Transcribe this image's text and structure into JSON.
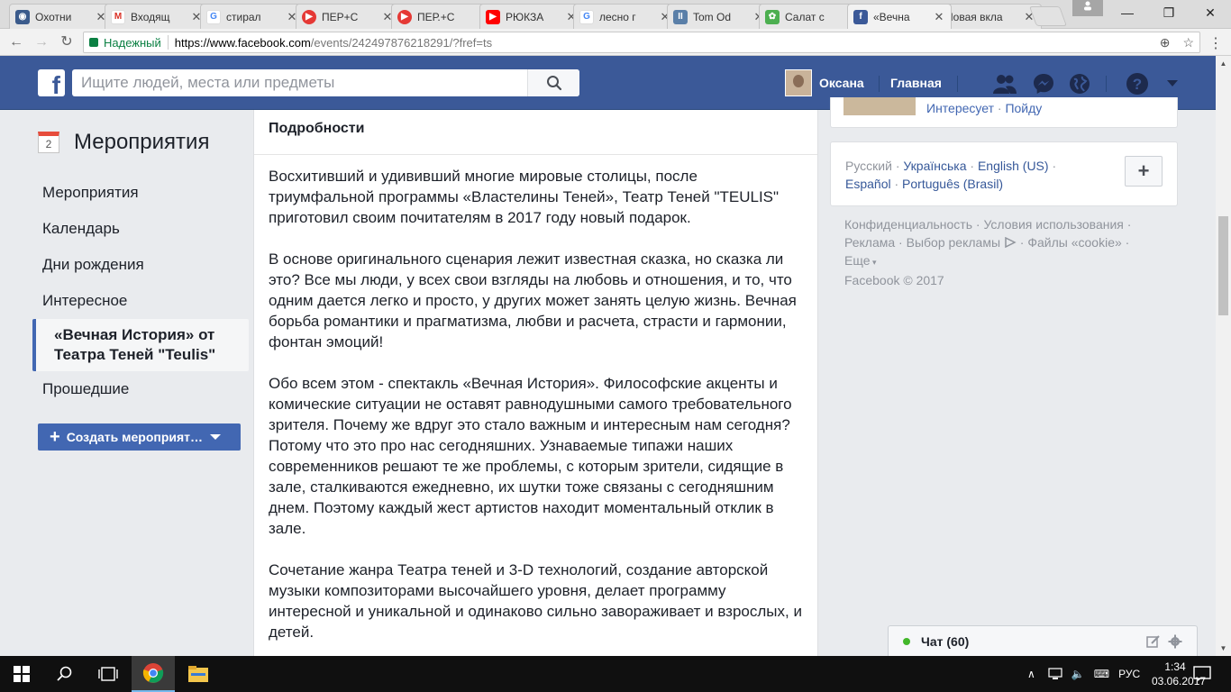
{
  "browser": {
    "tabs": [
      {
        "label": "Охотни",
        "icon": "globe-icon",
        "color": "#3b5b8c",
        "glyph": "◉",
        "active": false
      },
      {
        "label": "Входящ",
        "icon": "gmail-icon",
        "color": "#d93025",
        "glyph": "M",
        "active": false
      },
      {
        "label": "стирал",
        "icon": "google-icon",
        "color": "#4285f4",
        "glyph": "G",
        "active": false
      },
      {
        "label": "ПЕР+С",
        "icon": "media-play-icon",
        "color": "#e53935",
        "glyph": "▶",
        "active": false
      },
      {
        "label": "ПЕР.+С",
        "icon": "media-play-icon",
        "color": "#e53935",
        "glyph": "▶",
        "active": false
      },
      {
        "label": "РЮКЗА",
        "icon": "youtube-icon",
        "color": "#ff0000",
        "glyph": "▶",
        "active": false
      },
      {
        "label": "лесно г",
        "icon": "google-icon",
        "color": "#4285f4",
        "glyph": "G",
        "active": false
      },
      {
        "label": "Tom Od",
        "icon": "pause-icon",
        "color": "#5a7fa8",
        "glyph": "II",
        "active": false
      },
      {
        "label": "Салат с",
        "icon": "leaf-icon",
        "color": "#4caf50",
        "glyph": "✿",
        "active": false
      },
      {
        "label": "«Вечна",
        "icon": "facebook-icon",
        "color": "#3b5998",
        "glyph": "f",
        "active": true
      },
      {
        "label": "Новая вкла",
        "icon": "",
        "color": "",
        "glyph": "",
        "active": false
      }
    ],
    "security_label": "Надежный",
    "url_host": "https://www.facebook.com",
    "url_path": "/events/242497876218291/?fref=ts"
  },
  "fb": {
    "search_placeholder": "Ищите людей, места или предметы",
    "user_name": "Оксана",
    "home_label": "Главная"
  },
  "leftnav": {
    "title": "Мероприятия",
    "calendar_day": "2",
    "items": [
      {
        "label": "Мероприятия"
      },
      {
        "label": "Календарь"
      },
      {
        "label": "Дни рождения"
      },
      {
        "label": "Интересное"
      },
      {
        "label": "«Вечная История» от Театра Теней \"Teulis\"",
        "active": true
      },
      {
        "label": "Прошедшие"
      }
    ],
    "create_button": "Создать мероприят…"
  },
  "details": {
    "heading": "Подробности",
    "paragraphs": [
      "Восхитивший и удививший многие мировые столицы, после триумфальной программы «Властелины Теней», Театр Теней \"TEULIS\" приготовил своим почитателям в 2017 году новый подарок.",
      "В основе оригинального сценария лежит известная сказка, но сказка ли это? Все мы люди, у всех свои взгляды на любовь и отношения, и то, что одним дается легко и просто, у других может занять целую жизнь. Вечная борьба романтики и прагматизма, любви и расчета, страсти и гармонии, фонтан эмоций!",
      "Обо всем этом - спектакль «Вечная История». Философские акценты и комические ситуации не оставят равнодушными самого требовательного зрителя. Почему же вдруг это стало важным и интересным нам сегодня? Потому что это про нас сегодняшних. Узнаваемые типажи наших современников решают те же проблемы, с которым зрители, сидящие в зале, сталкиваются ежедневно, их шутки тоже связаны с сегодняшним днем. Поэтому каждый жест артистов находит моментальный отклик в зале.",
      "Сочетание жанра Театра теней и 3-D технологий, создание авторской музыки композиторами высочайшего уровня, делает программу интересной и уникальной и одинаково сильно завораживает и взрослых, и детей."
    ]
  },
  "right": {
    "event_links": [
      "Интересует",
      "Пойду"
    ],
    "languages": {
      "current": "Русский",
      "others": [
        "Українська",
        "English (US)",
        "Español",
        "Português (Brasil)"
      ]
    },
    "footer": {
      "privacy": "Конфиденциальность",
      "terms": "Условия использования",
      "ads": "Реклама",
      "ad_choices": "Выбор рекламы",
      "cookies": "Файлы «cookie»",
      "more": "Еще",
      "copyright": "Facebook © 2017"
    }
  },
  "chat": {
    "label": "Чат (60)"
  },
  "taskbar": {
    "language": "РУС",
    "time": "1:34",
    "date": "03.06.2017"
  },
  "colors": {
    "fb_blue": "#3b5998",
    "button_blue": "#4267b2",
    "link": "#365899",
    "online_green": "#42b72a"
  }
}
